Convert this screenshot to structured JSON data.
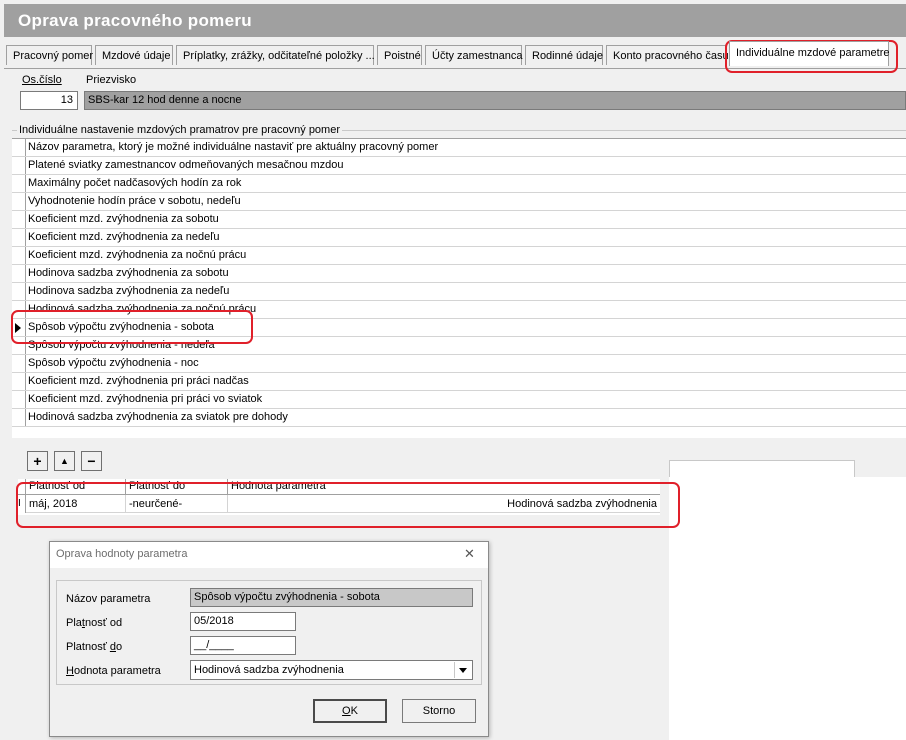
{
  "window": {
    "title": "Oprava pracovného pomeru"
  },
  "tabs": [
    {
      "label": "Pracovný pomer"
    },
    {
      "label": "Mzdové údaje"
    },
    {
      "label": "Príplatky, zrážky, odčitateľné položky ..."
    },
    {
      "label": "Poistné"
    },
    {
      "label": "Účty zamestnanca"
    },
    {
      "label": "Rodinné údaje"
    },
    {
      "label": "Konto pracovného času"
    },
    {
      "label": "Individuálne mzdové parametre"
    }
  ],
  "employee": {
    "os_cislo_label": "Os.číslo",
    "os_cislo_value": "13",
    "priezvisko_label": "Priezvisko",
    "priezvisko_value": "SBS-kar 12 hod denne a nocne"
  },
  "params_section": {
    "title": "Individuálne nastavenie mzdových pramatrov pre pracovný pomer",
    "header": "Názov parametra, ktorý je možné individuálne nastaviť pre aktuálny pracovný pomer",
    "rows": [
      "Platené sviatky zamestnancov odmeňovaných mesačnou mzdou",
      "Maximálny počet nadčasových hodín za rok",
      "Vyhodnotenie hodín práce v sobotu, nedeľu",
      "Koeficient mzd. zvýhodnenia za sobotu",
      "Koeficient mzd. zvýhodnenia za nedeľu",
      "Koeficient mzd. zvýhodnenia za nočnú prácu",
      "Hodinova sadzba zvýhodnenia za sobotu",
      "Hodinova sadzba zvýhodnenia za nedeľu",
      "Hodinová sadzba zvýhodnenia za nočnú prácu",
      "Spôsob výpočtu zvýhodnenia - sobota",
      "Spôsob výpočtu zvýhodnenia - nedeľa",
      "Spôsob výpočtu zvýhodnenia - noc",
      "Koeficient mzd. zvýhodnenia pri práci nadčas",
      "Koeficient mzd. zvýhodnenia pri práci vo sviatok",
      "Hodinová sadzba zvýhodnenia za sviatok pre dohody"
    ],
    "selected_index": 9
  },
  "toolbar": {
    "add": "+",
    "up": "▲",
    "remove": "−"
  },
  "values_grid": {
    "headers": [
      "Platnosť od",
      "Platnosť do",
      "Hodnota parametra"
    ],
    "rows": [
      {
        "indicator": "I",
        "od": "máj, 2018",
        "do": "-neurčené-",
        "hodnota": "Hodinová sadzba zvýhodnenia"
      }
    ]
  },
  "dialog": {
    "title": "Oprava hodnoty parametra",
    "close": "✕",
    "nazov_label": "Názov parametra",
    "nazov_value": "Spôsob výpočtu zvýhodnenia - sobota",
    "od_label_pre": "Pla",
    "od_label_u": "t",
    "od_label_post": "nosť od",
    "od_value": "05/2018",
    "do_label_pre": "Platnosť ",
    "do_label_u": "d",
    "do_label_post": "o",
    "do_value": "__/____",
    "hodnota_label_u": "H",
    "hodnota_label_post": "odnota parametra",
    "hodnota_value": "Hodinová sadzba zvýhodnenia",
    "ok_u": "O",
    "ok_post": "K",
    "storno": "Storno"
  },
  "colors": {
    "highlight": "#e0202a",
    "title_bar": "#a0a0a0"
  }
}
